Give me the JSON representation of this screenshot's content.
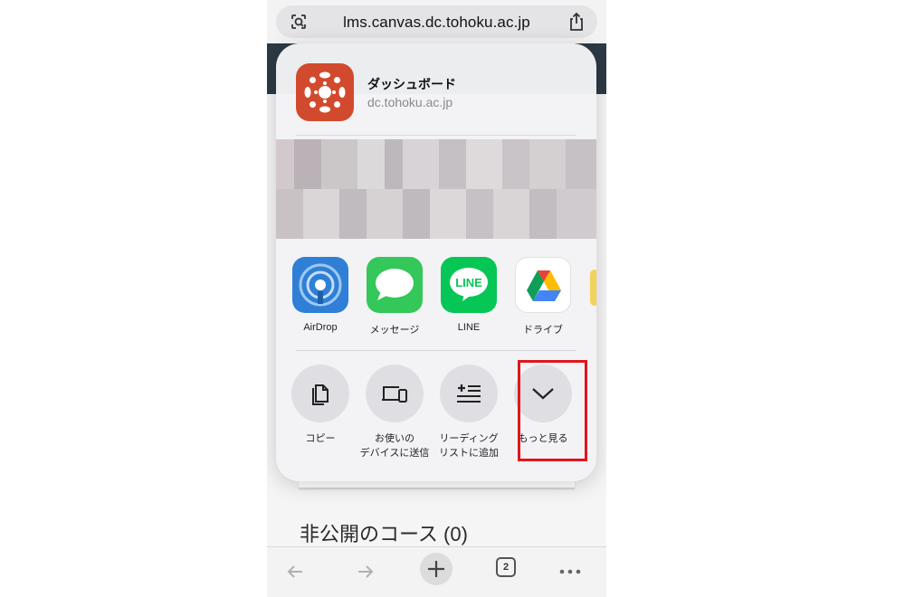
{
  "browser": {
    "url": "lms.canvas.dc.tohoku.ac.jp",
    "left_icon": "page-settings-icon",
    "share_icon": "share-icon"
  },
  "page": {
    "section_title": "非公開のコース (0)"
  },
  "share_sheet": {
    "title": "ダッシュボード",
    "subtitle": "dc.tohoku.ac.jp",
    "app_icon": "canvas-logo-icon",
    "apps": [
      {
        "label": "AirDrop",
        "icon": "airdrop-icon",
        "color": "#2f7fd6"
      },
      {
        "label": "メッセージ",
        "icon": "messages-icon",
        "color": "#34c759"
      },
      {
        "label": "LINE",
        "icon": "line-icon",
        "color": "#06c755"
      },
      {
        "label": "ドライブ",
        "icon": "google-drive-icon",
        "color": "#ffffff"
      }
    ],
    "actions": [
      {
        "label_line1": "コピー",
        "label_line2": "",
        "icon": "copy-icon"
      },
      {
        "label_line1": "お使いの",
        "label_line2": "デバイスに送信",
        "icon": "send-to-device-icon"
      },
      {
        "label_line1": "リーディング",
        "label_line2": "リストに追加",
        "icon": "reading-list-add-icon"
      },
      {
        "label_line1": "もっと見る",
        "label_line2": "",
        "icon": "chevron-down-icon"
      }
    ]
  },
  "bottom_bar": {
    "tab_count": "2",
    "back_icon": "back-arrow-icon",
    "forward_icon": "forward-arrow-icon",
    "new_tab_icon": "plus-icon",
    "menu_icon": "more-icon"
  },
  "colors": {
    "highlight": "#e0161c",
    "canvas_red": "#d24a2e"
  }
}
